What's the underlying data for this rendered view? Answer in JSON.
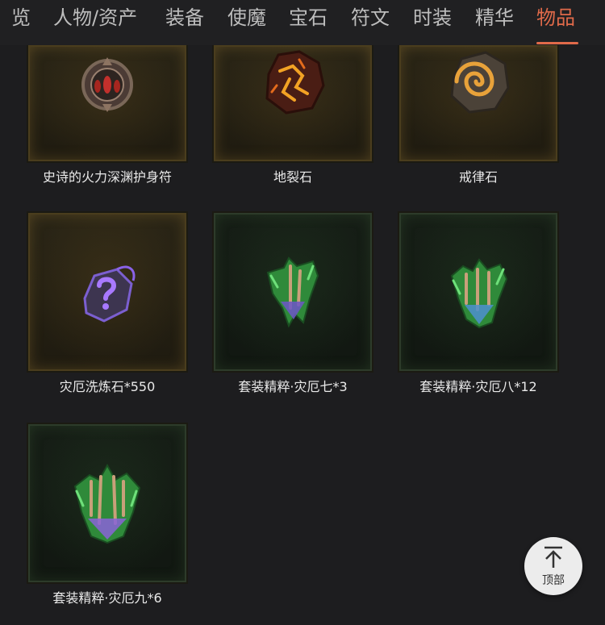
{
  "tabs": [
    {
      "label": "览",
      "active": false
    },
    {
      "label": "人物/资产",
      "active": false
    },
    {
      "label": "装备",
      "active": false
    },
    {
      "label": "使魔",
      "active": false
    },
    {
      "label": "宝石",
      "active": false
    },
    {
      "label": "符文",
      "active": false
    },
    {
      "label": "时装",
      "active": false
    },
    {
      "label": "精华",
      "active": false
    },
    {
      "label": "物品",
      "active": true
    }
  ],
  "items": [
    {
      "name": "史诗的火力深渊护身符",
      "rarity": "legendary-gold",
      "icon": "amulet-icon"
    },
    {
      "name": "地裂石",
      "rarity": "legendary-gold",
      "icon": "lava-rock-icon"
    },
    {
      "name": "戒律石",
      "rarity": "legendary-gold",
      "icon": "spiral-stone-icon"
    },
    {
      "name": "灾厄洗炼石*550",
      "rarity": "legendary-gold",
      "icon": "mystery-stone-icon"
    },
    {
      "name": "套装精粹·灾厄七*3",
      "rarity": "set-green",
      "icon": "set-essence-icon"
    },
    {
      "name": "套装精粹·灾厄八*12",
      "rarity": "set-green",
      "icon": "set-essence-icon"
    },
    {
      "name": "套装精粹·灾厄九*6",
      "rarity": "set-green",
      "icon": "set-essence-icon"
    }
  ],
  "back_to_top": {
    "label": "顶部",
    "icon": "arrow-up-to-top-icon"
  },
  "colors": {
    "accent": "#e06a4a",
    "background": "#1d1d1f",
    "gold_frame": "#4a3d1d",
    "green_frame": "#2d3b2a"
  }
}
